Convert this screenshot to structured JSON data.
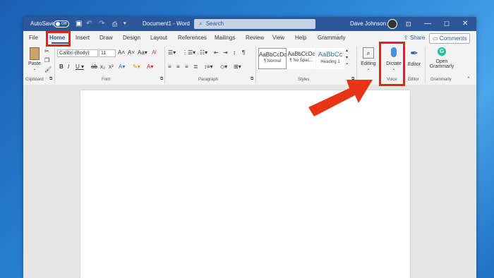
{
  "titlebar": {
    "autosave": "AutoSave",
    "toggle": "Off",
    "doc_title": "Document1 - Word",
    "search_placeholder": "Search",
    "user": "Dave Johnson"
  },
  "tabs": [
    "File",
    "Home",
    "Insert",
    "Draw",
    "Design",
    "Layout",
    "References",
    "Mailings",
    "Review",
    "View",
    "Help",
    "Grammarly"
  ],
  "actions": {
    "share": "Share",
    "comments": "Comments"
  },
  "ribbon": {
    "paste": "Paste",
    "font_name": "Calibri (Body)",
    "font_size": "11",
    "styles": [
      {
        "preview": "AaBbCcDc",
        "name": "¶ Normal"
      },
      {
        "preview": "AaBbCcDc",
        "name": "¶ No Spac..."
      },
      {
        "preview": "AaBbCc",
        "name": "Heading 1"
      }
    ],
    "editing": "Editing",
    "dictate": "Dictate",
    "editor": "Editor",
    "open_grammarly_1": "Open",
    "open_grammarly_2": "Grammarly",
    "groups": {
      "clipboard": "Clipboard",
      "font": "Font",
      "paragraph": "Paragraph",
      "styles": "Styles",
      "voice": "Voice",
      "editor": "Editor",
      "grammarly": "Grammarly"
    }
  },
  "colors": {
    "word_blue": "#2b579a",
    "highlight": "#e3221b",
    "arrow": "#e63414"
  }
}
